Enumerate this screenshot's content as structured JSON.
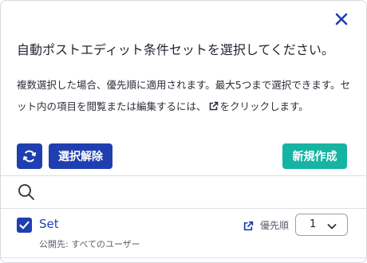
{
  "modal": {
    "title": "自動ポストエディット条件セットを選択してください。",
    "description_part1": "複数選択した場合、優先順に適用されます。最大5つまで選択できます。セット内の項目を閲覧または編集するには、",
    "description_part2": "をクリックします。",
    "close_icon": "close-icon"
  },
  "toolbar": {
    "refresh_icon": "refresh-icon",
    "clear_label": "選択解除",
    "new_label": "新規作成"
  },
  "colors": {
    "primary": "#1f3fb0",
    "success": "#17b3a3",
    "border": "#dcdfe4"
  },
  "search": {
    "icon": "search-icon",
    "value": "",
    "placeholder": ""
  },
  "sets": [
    {
      "name": "Set",
      "checked": true,
      "publish_label": "公開先: すべてのユーザー",
      "priority_label": "優先順",
      "priority_value": "1"
    }
  ]
}
